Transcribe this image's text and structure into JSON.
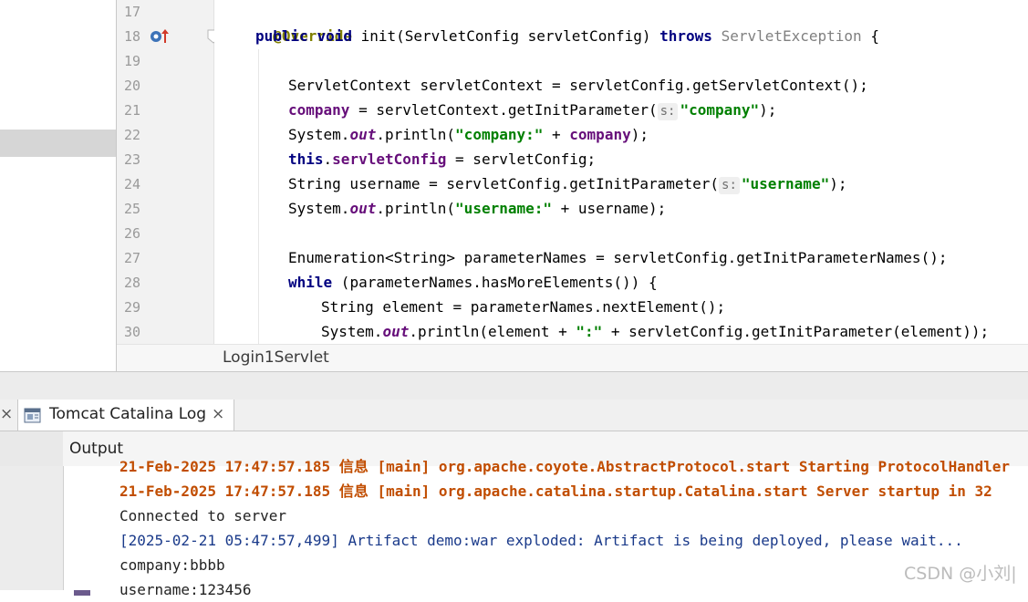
{
  "editor": {
    "line_numbers": [
      "17",
      "18",
      "19",
      "20",
      "21",
      "22",
      "23",
      "24",
      "25",
      "26",
      "27",
      "28",
      "29",
      "30"
    ],
    "line17": {
      "annotation": "@Override"
    },
    "line18": {
      "kw_public": "public",
      "kw_void": "void",
      "text1": " init(ServletConfig servletConfig) ",
      "kw_throws": "throws",
      "exception": "ServletException",
      "brace": " {"
    },
    "line20": {
      "text": "ServletContext servletContext = servletConfig.getServletContext();"
    },
    "line21": {
      "field": "company",
      "text1": " = servletContext.getInitParameter(",
      "hint": "s:",
      "string": "\"company\"",
      "text2": ");"
    },
    "line22": {
      "text1": "System.",
      "out": "out",
      "text2": ".println(",
      "string": "\"company:\"",
      "text3": " + ",
      "field": "company",
      "text4": ");"
    },
    "line23": {
      "kw_this": "this",
      "dot": ".",
      "field": "servletConfig",
      "text": " = servletConfig;"
    },
    "line24": {
      "text1": "String username = servletConfig.getInitParameter(",
      "hint": "s:",
      "string": "\"username\"",
      "text2": ");"
    },
    "line25": {
      "text1": "System.",
      "out": "out",
      "text2": ".println(",
      "string": "\"username:\"",
      "text3": " + username);"
    },
    "line27": {
      "text": "Enumeration<String> parameterNames = servletConfig.getInitParameterNames();"
    },
    "line28": {
      "kw_while": "while",
      "text": " (parameterNames.hasMoreElements()) {"
    },
    "line29": {
      "text": "String element = parameterNames.nextElement();"
    },
    "line30": {
      "text1": "System.",
      "out": "out",
      "text2": ".println(element + ",
      "string": "\":\"",
      "text3": " + servletConfig.getInitParameter(element));"
    },
    "breadcrumb": "Login1Servlet"
  },
  "panel": {
    "tab_prev_close": "×",
    "tab_label": "Tomcat Catalina Log",
    "tab_close": "×",
    "output_label": "Output"
  },
  "console": {
    "lines": [
      "21-Feb-2025 17:47:57.185 信息 [main] org.apache.coyote.AbstractProtocol.start Starting ProtocolHandler",
      "21-Feb-2025 17:47:57.185 信息 [main] org.apache.catalina.startup.Catalina.start Server startup in 32",
      "Connected to server",
      "[2025-02-21 05:47:57,499] Artifact demo:war exploded: Artifact is being deployed, please wait...",
      "company:bbbb",
      "username:123456"
    ]
  },
  "watermark": "CSDN @小刘|",
  "colors": {
    "keyword": "#000080",
    "string": "#008000",
    "field": "#660e7a",
    "annotation": "#808000",
    "log_error": "#c14d00"
  },
  "icons": [
    "override-method-icon",
    "fold-icon",
    "tomcat-log-icon",
    "scroll-up-icon",
    "scroll-down-icon",
    "soft-wrap-icon",
    "print-icon"
  ]
}
